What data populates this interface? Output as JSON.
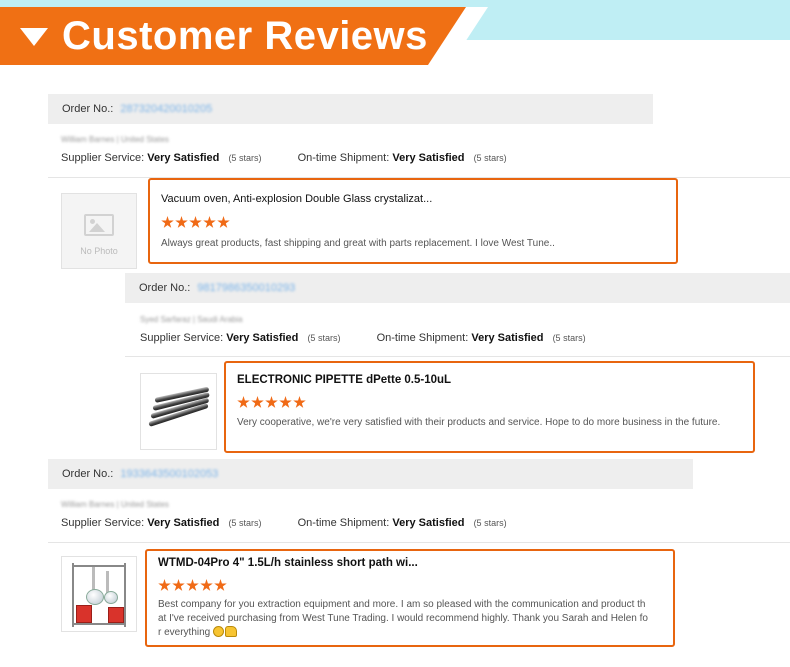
{
  "header": {
    "title": "Customer Reviews"
  },
  "labels": {
    "order_no": "Order No.:",
    "supplier_service": "Supplier Service:",
    "on_time_shipment": "On-time Shipment:"
  },
  "reviews": [
    {
      "order_number": "287320420010205",
      "buyer": "William Barnes | United States",
      "supplier_rating": "Very Satisfied",
      "supplier_stars": "(5 stars)",
      "shipment_rating": "Very Satisfied",
      "shipment_stars": "(5 stars)",
      "thumbnail": "No Photo",
      "product_title": "Vacuum oven, Anti-explosion Double Glass crystalizat...",
      "stars": 5,
      "text": "Always great products, fast shipping and great with parts replacement. I love West Tune.."
    },
    {
      "order_number": "9817986350010293",
      "buyer": "Syed Sarfaraz | Saudi Arabia",
      "supplier_rating": "Very Satisfied",
      "supplier_stars": "(5 stars)",
      "shipment_rating": "Very Satisfied",
      "shipment_stars": "(5 stars)",
      "thumbnail": "pipette-photo",
      "product_title": "ELECTRONIC PIPETTE dPette 0.5-10uL",
      "stars": 5,
      "text": "Very cooperative, we're very satisfied with their products and service. Hope to do more business in the future."
    },
    {
      "order_number": "1933643500102053",
      "buyer": "William Barnes | United States",
      "supplier_rating": "Very Satisfied",
      "supplier_stars": "(5 stars)",
      "shipment_rating": "Very Satisfied",
      "shipment_stars": "(5 stars)",
      "thumbnail": "distillation-photo",
      "product_title": "WTMD-04Pro 4\" 1.5L/h stainless short path wi...",
      "stars": 5,
      "text": "Best company for you extraction equipment and more. I am so pleased with the communication and product that I've received purchasing from West Tune Trading. I would recommend highly. Thank you Sarah and Helen for everything"
    }
  ],
  "colors": {
    "accent": "#f07014",
    "banner_bg": "#bfeef4",
    "order_bar": "#eeeeee",
    "star": "#f06a16"
  }
}
